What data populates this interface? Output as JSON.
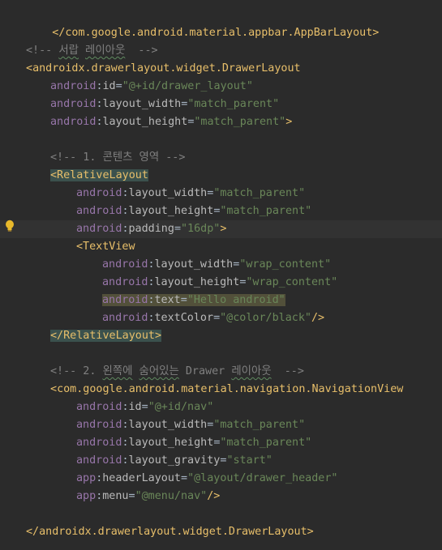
{
  "lines": [
    {
      "text": "</com.google.android.material.appbar.AppBarLayout>"
    },
    {
      "text": ""
    },
    {
      "comment_start": "<!-- ",
      "comment_word": "서랍",
      "comment_mid": " ",
      "comment_word2": "레이아웃",
      "comment_end": "  -->"
    },
    {
      "open": "<",
      "tag": "androidx.drawerlayout.widget.DrawerLayout"
    },
    {
      "ns": "android",
      "attr": "id",
      "value": "\"@+id/drawer_layout\""
    },
    {
      "ns": "android",
      "attr": "layout_width",
      "value": "\"match_parent\""
    },
    {
      "ns": "android",
      "attr": "layout_height",
      "value": "\"match_parent\"",
      "close": ">"
    },
    {
      "text": ""
    },
    {
      "comment": "<!-- 1. 콘텐츠 영역 -->"
    },
    {
      "tag": "<RelativeLayout"
    },
    {
      "ns": "android",
      "attr": "layout_width",
      "value": "\"match_parent\""
    },
    {
      "ns": "android",
      "attr": "layout_height",
      "value": "\"match_parent\""
    },
    {
      "ns": "android",
      "attr": "padding",
      "value": "\"16dp\"",
      "close": ">"
    },
    {
      "tag": "<TextView"
    },
    {
      "ns": "android",
      "attr": "layout_width",
      "value": "\"wrap_content\""
    },
    {
      "ns": "android",
      "attr": "layout_height",
      "value": "\"wrap_content\""
    },
    {
      "ns": "android",
      "attr": "text",
      "value": "\"Hello android\""
    },
    {
      "ns": "android",
      "attr": "textColor",
      "value": "\"@color/black\"",
      "close": "/>"
    },
    {
      "tag": "</RelativeLayout>"
    },
    {
      "text": ""
    },
    {
      "comment_start": "<!-- 2. ",
      "comment_word": "왼쪽에",
      "comment_mid": " ",
      "comment_word2": "숨어있는",
      "comment_rest": " Drawer ",
      "comment_word3": "레이아웃",
      "comment_end": "  -->"
    },
    {
      "open": "<",
      "tag": "com.google.android.material.navigation.NavigationView"
    },
    {
      "ns": "android",
      "attr": "id",
      "value": "\"@+id/nav\""
    },
    {
      "ns": "android",
      "attr": "layout_width",
      "value": "\"match_parent\""
    },
    {
      "ns": "android",
      "attr": "layout_height",
      "value": "\"match_parent\""
    },
    {
      "ns": "android",
      "attr": "layout_gravity",
      "value": "\"start\""
    },
    {
      "ns": "app",
      "attr": "headerLayout",
      "value": "\"@layout/drawer_header\""
    },
    {
      "ns": "app",
      "attr": "menu",
      "value": "\"@menu/nav\"",
      "close": "/>"
    },
    {
      "text": ""
    },
    {
      "tag": "</androidx.drawerlayout.widget.DrawerLayout>"
    }
  ],
  "colon": ":",
  "equals": "=",
  "gutter": {
    "icon": "lightbulb-icon"
  }
}
